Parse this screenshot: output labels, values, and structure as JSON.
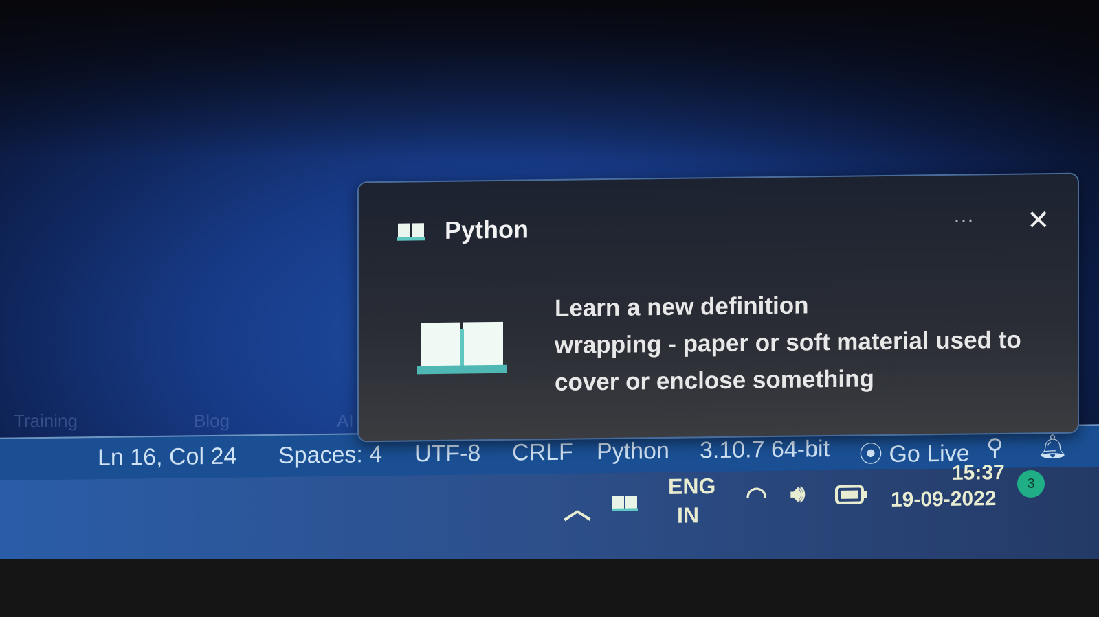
{
  "background_tabs": [
    "Training",
    "Blog",
    "AI"
  ],
  "statusbar": {
    "position": "Ln 16, Col 24",
    "spaces": "Spaces: 4",
    "encoding": "UTF-8",
    "eol": "CRLF",
    "language": "Python",
    "interpreter": "3.10.7 64-bit",
    "go_live": "Go Live"
  },
  "toast": {
    "app": "Python",
    "icon": "book-icon",
    "heading": "Learn a new definition",
    "lines": [
      "wrapping - paper or soft material used to",
      "cover or enclose something"
    ]
  },
  "taskbar": {
    "lang1": "ENG",
    "lang2": "IN",
    "time": "15:37",
    "date": "19-09-2022",
    "notifications": "3"
  },
  "colors": {
    "accent": "#1fae86",
    "statusbar": "#1a4f93",
    "icon": "#7fe3e0"
  }
}
